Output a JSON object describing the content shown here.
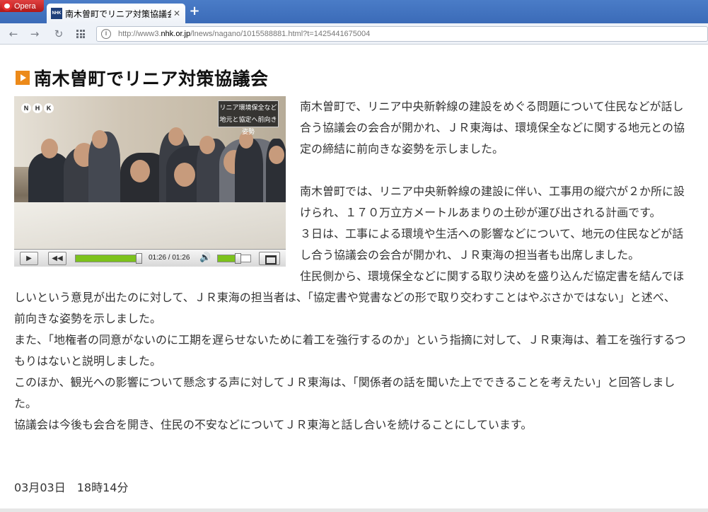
{
  "browser": {
    "menu_label": "Opera",
    "tab_title": "南木曽町でリニア対策協議会",
    "tab_favicon_text": "NHK",
    "url_prefix": "http://www3.",
    "url_host": "nhk.or.jp",
    "url_path": "/lnews/nagano/1015588881.html?t=1425441675004"
  },
  "article": {
    "headline": "南木曽町でリニア対策協議会",
    "video": {
      "logo_letters": [
        "N",
        "H",
        "K"
      ],
      "caption_line1": "リニア環境保全など",
      "caption_line2": "地元と協定へ前向き姿勢",
      "time": "01:26 / 01:26",
      "progress": 1.0,
      "volume": 0.6
    },
    "paragraphs": [
      "南木曽町で、リニア中央新幹線の建設をめぐる問題について住民などが話し合う協議会の会合が開かれ、ＪＲ東海は、環境保全などに関する地元との協定の締結に前向きな姿勢を示しました。",
      "",
      "南木曽町では、リニア中央新幹線の建設に伴い、工事用の縦穴が２か所に設けられ、１７０万立方メートルあまりの土砂が運び出される計画です。",
      "３日は、工事による環境や生活への影響などについて、地元の住民などが話し合う協議会の会合が開かれ、ＪＲ東海の担当者も出席しました。",
      "住民側から、環境保全などに関する取り決めを盛り込んだ協定書を結んでほしいという意見が出たのに対して、ＪＲ東海の担当者は、「協定書や覚書などの形で取り交わすことはやぶさかではない」と述べ、前向きな姿勢を示しました。",
      "また、「地権者の同意がないのに工期を遅らせないために着工を強行するのか」という指摘に対して、ＪＲ東海は、着工を強行するつもりはないと説明しました。",
      "このほか、観光への影響について懸念する声に対してＪＲ東海は、「関係者の話を聞いた上でできることを考えたい」と回答しました。",
      "協議会は今後も会合を開き、住民の不安などについてＪＲ東海と話し合いを続けることにしています。"
    ],
    "dateline": "03月03日　18時14分"
  }
}
